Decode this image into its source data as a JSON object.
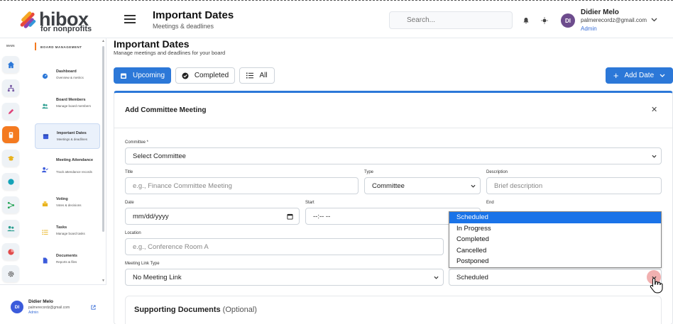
{
  "brand": {
    "name": "hibox",
    "tagline": "for nonprofits"
  },
  "header": {
    "title": "Important Dates",
    "subtitle": "Meetings & deadlines",
    "search_placeholder": "Search...",
    "user": {
      "initials": "DI",
      "name": "Didier Melo",
      "email": "palmerecordz@gmail.com",
      "role": "Admin"
    }
  },
  "sidebar": {
    "rail_label": "MAIN",
    "section_label": "BOARD MANAGEMENT",
    "items": [
      {
        "label": "Dashboard",
        "desc": "Overview & metrics"
      },
      {
        "label": "Board Members",
        "desc": "Manage board members"
      },
      {
        "label": "Important Dates",
        "desc": "Meetings & deadlines"
      },
      {
        "label": "Meeting Attendance",
        "desc": "Track attendance records"
      },
      {
        "label": "Voting",
        "desc": "Votes & decisions"
      },
      {
        "label": "Tasks",
        "desc": "Manage board tasks"
      },
      {
        "label": "Documents",
        "desc": "Reports & files"
      }
    ],
    "footer_user": {
      "initials": "DI",
      "name": "Didier Melo",
      "email": "palmerecordz@gmail.com",
      "role": "Admin"
    }
  },
  "main": {
    "title": "Important Dates",
    "subtitle": "Manage meetings and deadlines for your board",
    "tabs": {
      "upcoming": "Upcoming",
      "completed": "Completed",
      "all": "All"
    },
    "add_button": "Add Date"
  },
  "form": {
    "title": "Add Committee Meeting",
    "committee_label": "Committee *",
    "committee_value": "Select Committee",
    "title_label": "Title",
    "title_placeholder": "e.g., Finance Committee Meeting",
    "type_label": "Type",
    "type_value": "Committee",
    "description_label": "Description",
    "description_placeholder": "Brief description",
    "date_label": "Date",
    "date_placeholder": "mm/dd/yyyy",
    "start_label": "Start",
    "start_placeholder": "--:-- --",
    "end_label": "End",
    "location_label": "Location",
    "location_placeholder": "e.g., Conference Room A",
    "link_type_label": "Meeting Link Type",
    "link_type_value": "No Meeting Link",
    "status_value": "Scheduled",
    "status_options": [
      "Scheduled",
      "In Progress",
      "Completed",
      "Cancelled",
      "Postponed"
    ],
    "supporting_title": "Supporting Documents",
    "supporting_optional": "(Optional)"
  },
  "colors": {
    "primary": "#2c78d8",
    "sidebar_active": "#eaf1fb",
    "accent_orange": "#f47a20"
  }
}
